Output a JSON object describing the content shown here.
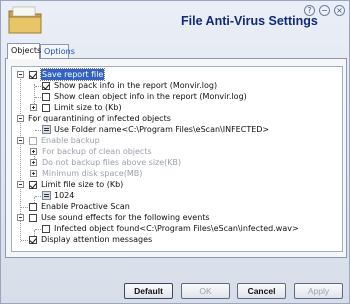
{
  "window": {
    "title": "File Anti-Virus Settings",
    "icon": "folder-icon"
  },
  "window_controls": {
    "help": "?",
    "minimize": "−",
    "close": "×"
  },
  "tabs": [
    {
      "label": "Objects"
    },
    {
      "label": "Options",
      "active": false
    }
  ],
  "watermark": "",
  "tree": {
    "save_report": {
      "label": "Save report file",
      "checked": true,
      "selected": true
    },
    "show_pack": {
      "label": "Show pack info in the report (Monvir.log)",
      "checked": true
    },
    "show_clean": {
      "label": "Show clean object info in the report (Monvir.log)",
      "checked": false
    },
    "limit_size_report": {
      "label": "Limit size to (Kb)",
      "checked": false
    },
    "quarantine": {
      "label": "For quarantining of infected objects"
    },
    "use_folder": {
      "label": "Use Folder name<C:\\Program Files\\eScan\\INFECTED>"
    },
    "enable_backup": {
      "label": "Enable backup",
      "checked": false,
      "disabled": true
    },
    "backup_clean": {
      "label": "For backup of clean objects",
      "disabled": true
    },
    "no_backup_size": {
      "label": "Do not backup files above size(KB)",
      "disabled": true
    },
    "min_disk": {
      "label": "Minimum disk space(MB)",
      "disabled": true
    },
    "limit_file_size": {
      "label": "Limit file size to (Kb)",
      "checked": true
    },
    "limit_value": {
      "label": "1024"
    },
    "proactive": {
      "label": "Enable Proactive Scan",
      "checked": false
    },
    "sound": {
      "label": "Use sound effects for the following events",
      "checked": false
    },
    "infected_sound": {
      "label": "Infected object found<C:\\Program Files\\eScan\\infected.wav>",
      "checked": false
    },
    "attention": {
      "label": "Display attention messages",
      "checked": true
    }
  },
  "buttons": {
    "default": "Default",
    "ok": "OK",
    "cancel": "Cancel",
    "apply": "Apply"
  }
}
